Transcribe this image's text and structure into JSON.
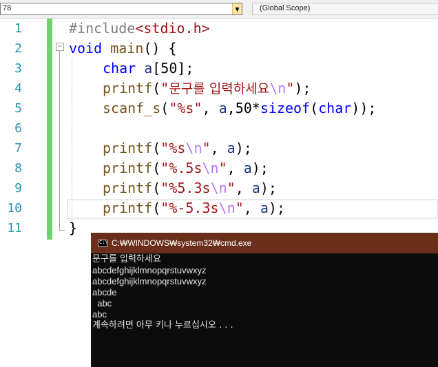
{
  "navbar": {
    "left_combo_value": "78",
    "right_combo_value": "(Global Scope)"
  },
  "editor": {
    "line_numbers": [
      "1",
      "2",
      "3",
      "4",
      "5",
      "6",
      "7",
      "8",
      "9",
      "10",
      "11"
    ],
    "fold_glyph": "−",
    "lines": {
      "l1": {
        "pp": "#include",
        "inc": "<stdio.h>"
      },
      "l2": {
        "kw": "void",
        "sp": " ",
        "fn": "main",
        "rest": "() {"
      },
      "l3": {
        "kw": "char",
        "sp": " ",
        "var": "a",
        "rest": "[50];"
      },
      "l4": {
        "fn": "printf",
        "p1": "(",
        "q1": "\"",
        "text": "문구를 입력하세요",
        "esc": "\\n",
        "q2": "\"",
        "rest": ");"
      },
      "l5": {
        "fn": "scanf_s",
        "p1": "(",
        "str": "\"%s\"",
        "c1": ", ",
        "var": "a",
        "mid": ",50*",
        "kw": "sizeof",
        "p2": "(",
        "kw2": "char",
        "rest": "));"
      },
      "l7": {
        "fn": "printf",
        "p1": "(",
        "s1": "\"",
        "fmt": "%s",
        "esc": "\\n",
        "s2": "\"",
        "c1": ", ",
        "var": "a",
        "rest": ");"
      },
      "l8": {
        "fn": "printf",
        "p1": "(",
        "s1": "\"",
        "fmt": "%.5s",
        "esc": "\\n",
        "s2": "\"",
        "c1": ", ",
        "var": "a",
        "rest": ");"
      },
      "l9": {
        "fn": "printf",
        "p1": "(",
        "s1": "\"",
        "fmt": "%5.3s",
        "esc": "\\n",
        "s2": "\"",
        "c1": ", ",
        "var": "a",
        "rest": ");"
      },
      "l10": {
        "fn": "printf",
        "p1": "(",
        "s1": "\"",
        "fmt": "%-5.3s",
        "esc": "\\n",
        "s2": "\"",
        "c1": ", ",
        "var": "a",
        "rest": ");"
      },
      "l11": {
        "rest": "}"
      }
    }
  },
  "console": {
    "title": "C:₩WINDOWS₩system32₩cmd.exe",
    "icon_text": "C:\\",
    "output": [
      "문구를 입력하세요",
      "abcdefghijklmnopqrstuvwxyz",
      "abcdefghijklmnopqrstuvwxyz",
      "abcde",
      "  abc",
      "abc",
      "계속하려면 아무 키나 누르십시오 . . ."
    ]
  },
  "colors": {
    "keyword": "#0000ff",
    "string": "#a31515",
    "escape": "#b776fb",
    "function": "#74531f",
    "variable": "#1f377f",
    "line_number": "#2b91af",
    "change_bar": "#6cd46c",
    "console_title_bg": "#6b2e1b",
    "console_bg": "#0c0c0c"
  }
}
